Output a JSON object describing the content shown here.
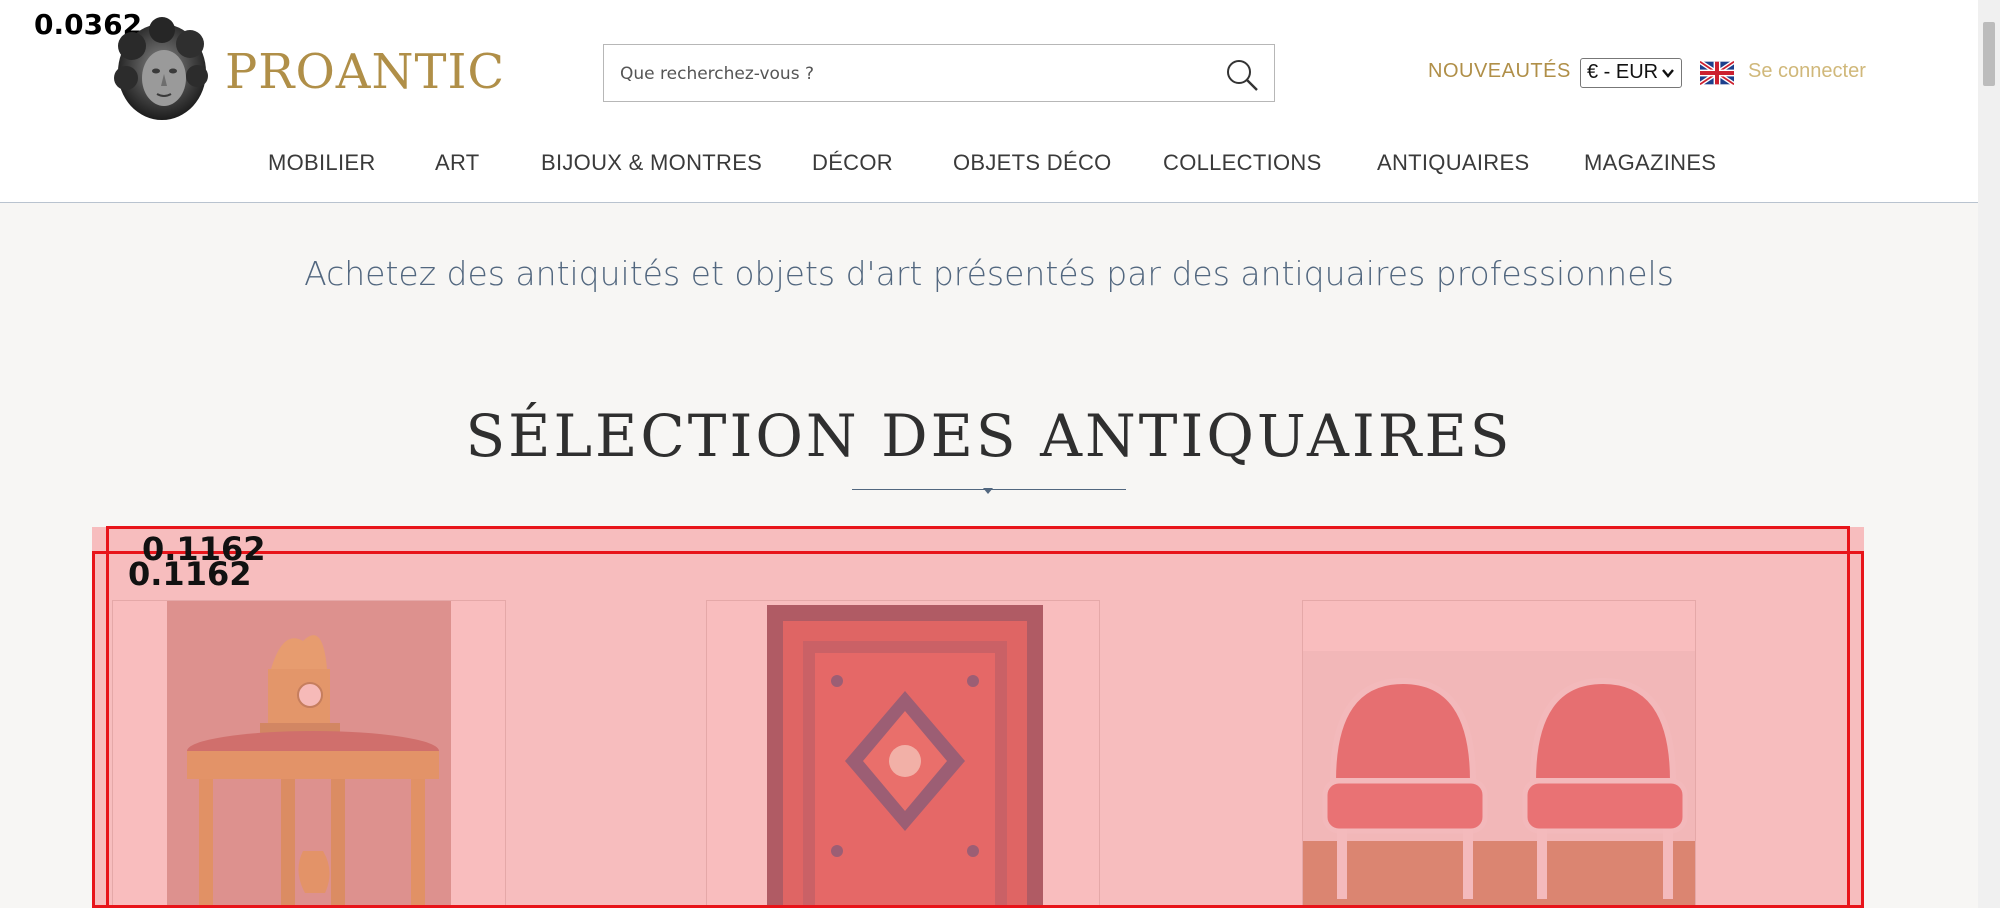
{
  "overlay": {
    "top_label": "0.0362",
    "box_label_outer": "0.1162",
    "box_label_inner": "0.1162"
  },
  "header": {
    "logo_text": "PROANTIC",
    "search": {
      "placeholder": "Que recherchez-vous ?"
    },
    "new_link": "NOUVEAUTÉS",
    "currency": "€ - EUR",
    "login": "Se connecter"
  },
  "nav": {
    "items": [
      "MOBILIER",
      "ART",
      "BIJOUX & MONTRES",
      "DÉCOR",
      "OBJETS DÉCO",
      "COLLECTIONS",
      "ANTIQUAIRES",
      "MAGAZINES"
    ]
  },
  "main": {
    "tagline": "Achetez des antiquités et objets d'art présentés par des antiquaires professionnels",
    "section_title": "SÉLECTION DES ANTIQUAIRES"
  },
  "cards": {
    "items": [
      {
        "kind": "console-clock"
      },
      {
        "kind": "persian-rug"
      },
      {
        "kind": "pair-armchairs"
      }
    ]
  },
  "colors": {
    "gold": "#b08f48",
    "slate": "#52677f",
    "highlight": "#e8141a"
  }
}
